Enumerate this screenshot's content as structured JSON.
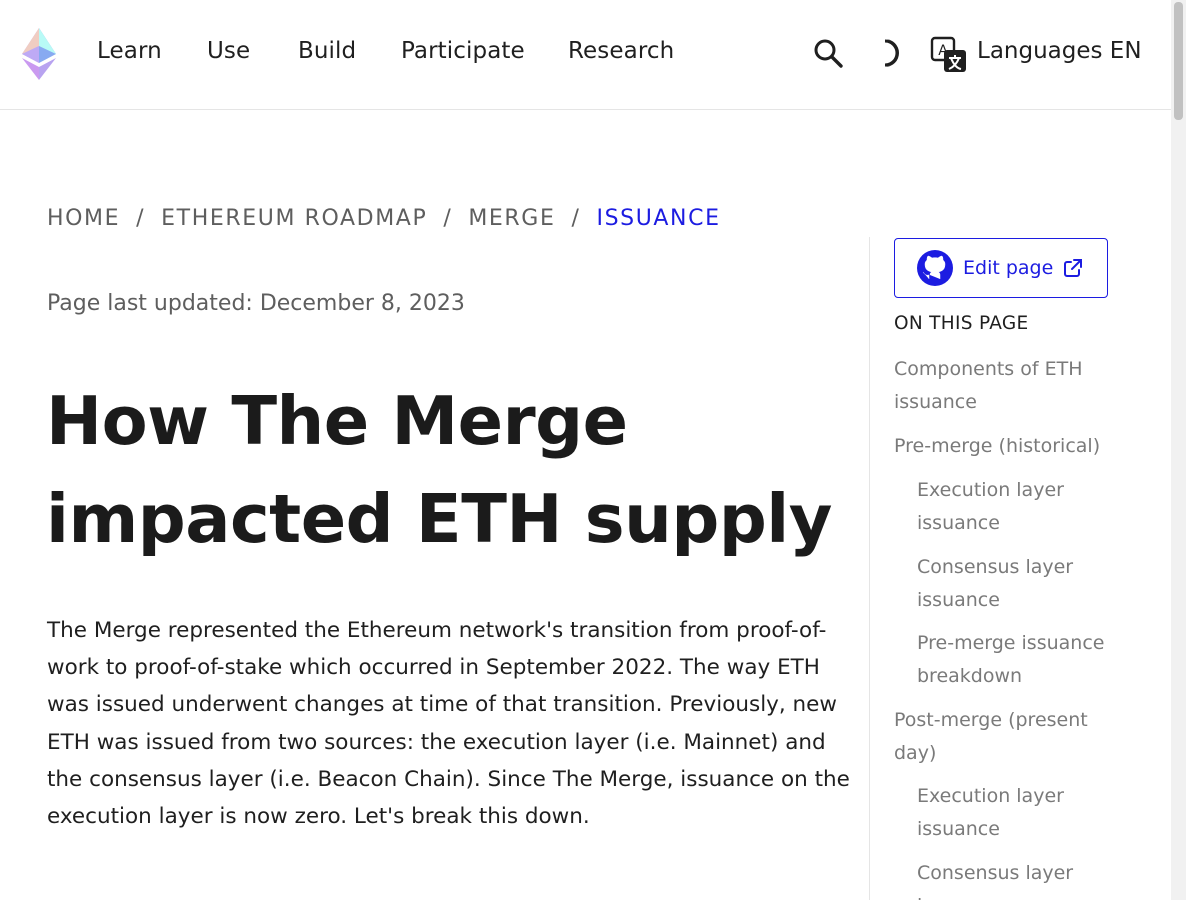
{
  "nav": {
    "links": [
      "Learn",
      "Use",
      "Build",
      "Participate",
      "Research"
    ],
    "search_icon": "search-icon",
    "theme_icon": "moon-icon",
    "language_icon": "translate-icon",
    "language_label": "Languages EN"
  },
  "breadcrumb": {
    "items": [
      "HOME",
      "ETHEREUM ROADMAP",
      "MERGE",
      "ISSUANCE"
    ],
    "separator": "/"
  },
  "page": {
    "last_updated": "Page last updated: December 8, 2023",
    "title_line1": "How The Merge",
    "title_line2": "impacted ETH supply",
    "intro": "The Merge represented the Ethereum network's transition from proof-of-work to proof-of-stake which occurred in September 2022. The way ETH was issued underwent changes at time of that transition. Previously, new ETH was issued from two sources: the execution layer (i.e. Mainnet) and the consensus layer (i.e. Beacon Chain). Since The Merge, issuance on the execution layer is now zero. Let's break this down."
  },
  "sidebar": {
    "edit_label": "Edit page",
    "toc_heading": "ON THIS PAGE",
    "toc": [
      {
        "line1": "Components of ETH",
        "line2": "issuance"
      },
      {
        "line1": "Pre-merge (historical)",
        "line2": ""
      },
      {
        "line1": "Execution layer",
        "line2": "issuance"
      },
      {
        "line1": "Consensus layer",
        "line2": "issuance"
      },
      {
        "line1": "Pre-merge issuance",
        "line2": "breakdown"
      },
      {
        "line1": "Post-merge (present",
        "line2": "day)"
      },
      {
        "line1": "Execution layer",
        "line2": "issuance"
      },
      {
        "line1": "Consensus layer",
        "line2": "issuance"
      }
    ]
  },
  "colors": {
    "accent": "#1c1ce1",
    "muted_text": "#5e5e5e",
    "toc_text": "#7a7a7a"
  }
}
